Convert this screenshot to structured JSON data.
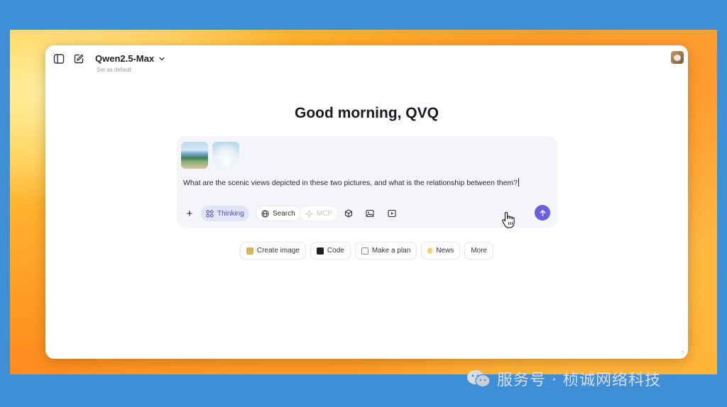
{
  "app": {
    "model_name": "Qwen2.5-Max",
    "model_subtitle": "Set as default",
    "corner_mark": "?"
  },
  "main": {
    "greeting": "Good morning, QVQ",
    "prompt_text": "What are the scenic views depicted in these two pictures, and what is the relationship between them?"
  },
  "toolbar": {
    "thinking_label": "Thinking",
    "search_label": "Search",
    "mcp_label": "MCP",
    "plus_label": "+"
  },
  "suggestions": [
    {
      "label": "Create image",
      "icon": "palette-icon",
      "color": "#c9a24a"
    },
    {
      "label": "Code",
      "icon": "terminal-icon",
      "color": "#1e1e24"
    },
    {
      "label": "Make a plan",
      "icon": "calendar-icon",
      "color": "#8a8a96"
    },
    {
      "label": "News",
      "icon": "lightbulb-icon",
      "color": "#e8c23c"
    },
    {
      "label": "More",
      "icon": "",
      "color": ""
    }
  ],
  "watermark": {
    "text": "服务号 · 桢诚网络科技"
  },
  "colors": {
    "send_button": "#6a5fe0",
    "thinking_bg": "#e3e4f7",
    "composer_bg": "#f4f5fb",
    "desktop_blue": "#3f8fd6"
  }
}
